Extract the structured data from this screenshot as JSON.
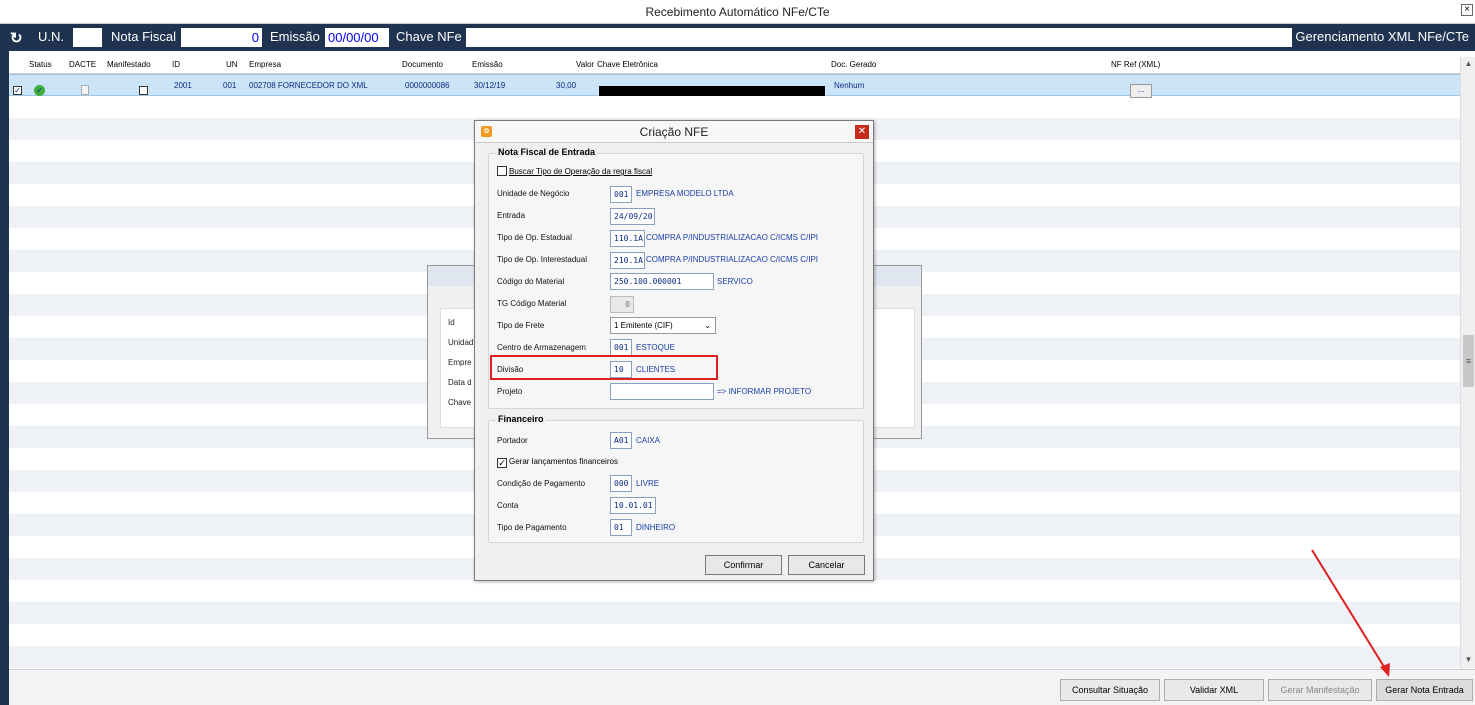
{
  "window": {
    "title": "Recebimento Automático NFe/CTe",
    "close": "×"
  },
  "toolbar": {
    "refresh_icon": "refresh-icon",
    "un_label": "U.N.",
    "un_value": "",
    "nota_label": "Nota Fiscal",
    "nota_value": "0",
    "emissao_label": "Emissão",
    "emissao_value": "00/00/00",
    "chave_label": "Chave NFe",
    "chave_value": "",
    "gerenciamento": "Gerenciamento XML NFe/CTe"
  },
  "grid": {
    "columns": [
      "Status",
      "DACTE",
      "Manifestado",
      "ID",
      "UN",
      "Empresa",
      "Documento",
      "Emissão",
      "Valor",
      "Chave Eletrônica",
      "Doc. Gerado",
      "NF Ref (XML)"
    ],
    "row": {
      "id": "2001",
      "un": "001",
      "empresa": "002708  FORNECEDOR DO XML",
      "documento": "0000000086",
      "emissao": "30/12/19",
      "valor": "30,00",
      "doc_gerado": "Nenhum",
      "nf_ref_button": "..."
    }
  },
  "bgpanel": {
    "labels": [
      "Id",
      "Unidad",
      "Empre",
      "Data d",
      "Chave"
    ]
  },
  "dialog": {
    "title": "Criação NFE",
    "group_entrada": "Nota Fiscal de Entrada",
    "buscar_tipo": "Buscar Tipo de Operação da regra fiscal",
    "unidade_label": "Unidade de Negócio",
    "unidade_code": "001",
    "unidade_desc": "EMPRESA MODELO LTDA",
    "entrada_label": "Entrada",
    "entrada_value": "24/09/20",
    "tipo_est_label": "Tipo de Op. Estadual",
    "tipo_est_code": "110.1A",
    "tipo_est_desc": "COMPRA P/INDUSTRIALIZACAO C/ICMS C/IPI",
    "tipo_inter_label": "Tipo de Op. Interestadual",
    "tipo_inter_code": "210.1A",
    "tipo_inter_desc": "COMPRA P/INDUSTRIALIZACAO C/ICMS C/IPI",
    "codmat_label": "Código do Material",
    "codmat_value": "250.100.000001",
    "codmat_desc": "SERVICO",
    "tgcod_label": "TG Código Material",
    "tgcod_value": "0",
    "frete_label": "Tipo de Frete",
    "frete_value": "1 Emitente (CIF)",
    "centro_label": "Centro de Armazenagem",
    "centro_code": "001",
    "centro_desc": "ESTOQUE",
    "divisao_label": "Divisão",
    "divisao_code": "10",
    "divisao_desc": "CLIENTES",
    "projeto_label": "Projeto",
    "projeto_value": "",
    "projeto_desc": "=> INFORMAR PROJETO",
    "group_fin": "Financeiro",
    "portador_label": "Portador",
    "portador_code": "A01",
    "portador_desc": "CAIXA",
    "gerar_lanc": "Gerar lançamentos financeiros",
    "cond_label": "Condição de Pagamento",
    "cond_code": "000",
    "cond_desc": "LIVRE",
    "conta_label": "Conta",
    "conta_value": "10.01.01",
    "tipopag_label": "Tipo de Pagamento",
    "tipopag_code": "01",
    "tipopag_desc": "DINHEIRO",
    "confirmar": "Confirmar",
    "cancelar": "Cancelar"
  },
  "actions": {
    "consultar": "Consultar Situação",
    "validar": "Validar XML",
    "manifestacao": "Gerar Manifestação",
    "gerar_nota": "Gerar Nota Entrada"
  }
}
